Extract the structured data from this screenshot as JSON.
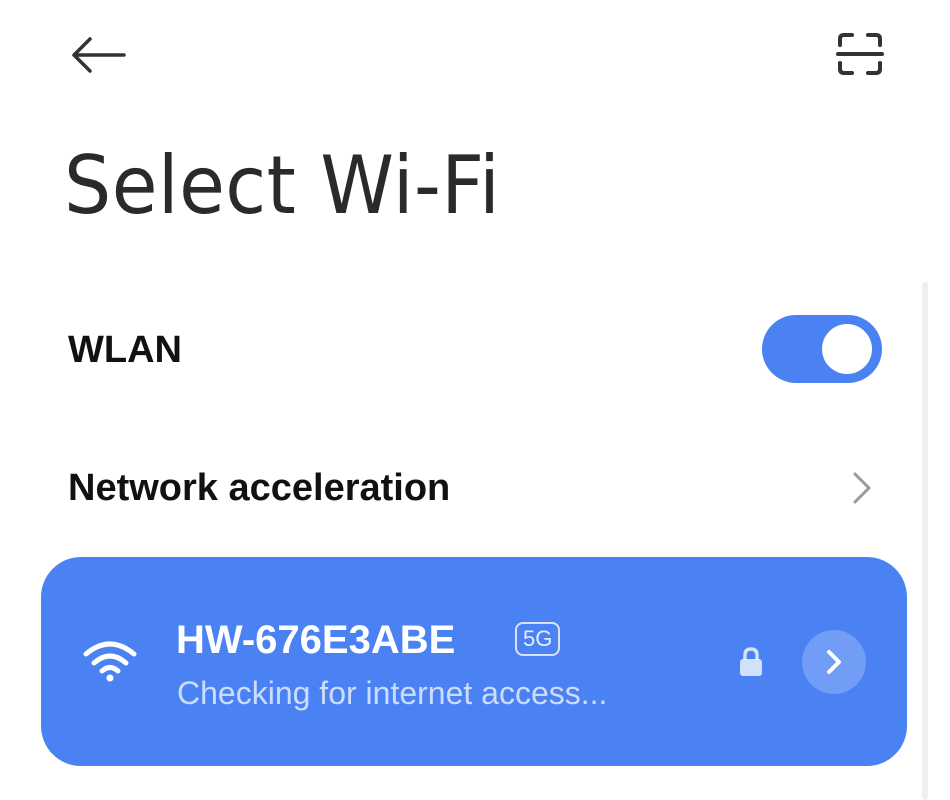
{
  "header": {
    "back_icon": "arrow-left-icon",
    "scan_icon": "qr-scan-icon",
    "title": "Select Wi-Fi"
  },
  "settings": {
    "wlan": {
      "label": "WLAN",
      "enabled": true,
      "toggle_color": "#4a82f4"
    },
    "network_acceleration": {
      "label": "Network acceleration",
      "icon": "chevron-right-icon"
    }
  },
  "connected_network": {
    "ssid": "HW-676E3ABE",
    "band": "5G",
    "status": "Checking for internet access...",
    "secured": true,
    "signal_icon": "wifi-icon",
    "lock_icon": "lock-icon",
    "details_icon": "chevron-right-icon",
    "card_color": "#4a82f4"
  }
}
